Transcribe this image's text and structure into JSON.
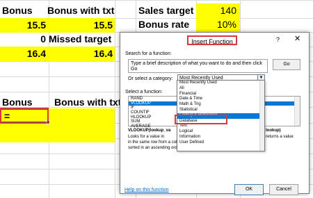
{
  "sheet": {
    "headers": {
      "bonus": "Bonus",
      "bonus_with_txt": "Bonus with txt"
    },
    "rows": [
      {
        "bonus": "15.5",
        "bonus_with_txt": "15.5"
      },
      {
        "bonus": "0",
        "bonus_with_txt": "Missed target"
      },
      {
        "bonus": "16.4",
        "bonus_with_txt": "16.4"
      }
    ],
    "sales_target_label": "Sales target",
    "sales_target_value": "140",
    "bonus_rate_label": "Bonus rate",
    "bonus_rate_value": "10%",
    "lower_headers": {
      "bonus": "Bonus",
      "bonus_with_txt": "Bonus with txt"
    },
    "active_cell_value": "=",
    "fill_color": "#ffff00"
  },
  "dialog": {
    "title": "Insert Function",
    "help_glyph": "?",
    "close_glyph": "✕",
    "search_label": "Search for a function:",
    "search_value": "Type a brief description of what you want to do and then click Go",
    "go_label": "Go",
    "category_label": "Or select a category:",
    "category_value": "Most Recently Used",
    "select_function_label": "Select a function:",
    "functions": [
      "RAND",
      "VLOOKUP",
      "IF",
      "COUNTIF",
      "HLOOKUP",
      "SUM",
      "AVERAGE"
    ],
    "selected_function": "VLOOKUP",
    "signature": "VLOOKUP(lookup_va",
    "signature_tail": "lookup)",
    "description_line1": "Looks for a value in",
    "description_line1_tail": "returns a value",
    "description_line2": "in the same row from a column you specify. By default, the table must be",
    "description_line3": "sorted in an ascending order.",
    "help_link": "Help on this function",
    "ok_label": "OK",
    "cancel_label": "Cancel",
    "category_options": [
      "Most Recently Used",
      "All",
      "Financial",
      "Date & Time",
      "Math & Trig",
      "Statistical",
      "Lookup & Reference",
      "Database",
      "Text",
      "Logical",
      "Information",
      "User Defined"
    ],
    "selected_category": "Lookup & Reference",
    "accent_color": "#0078d7",
    "callout_color": "#d9363e"
  }
}
